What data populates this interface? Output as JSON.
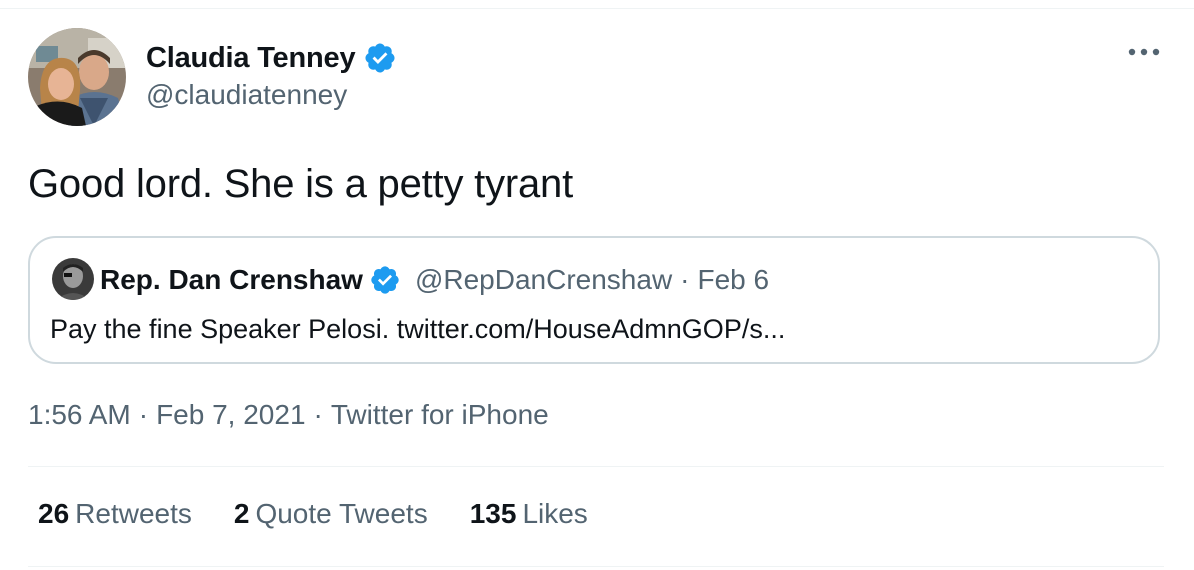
{
  "tweet": {
    "author": {
      "display_name": "Claudia Tenney",
      "handle": "@claudiatenney",
      "verified": true
    },
    "text": "Good lord. She is a petty tyrant",
    "quoted": {
      "author": {
        "display_name": "Rep. Dan Crenshaw",
        "handle": "@RepDanCrenshaw",
        "verified": true
      },
      "separator": "·",
      "date": "Feb 6",
      "text": "Pay the fine Speaker Pelosi. twitter.com/HouseAdmnGOP/s..."
    },
    "meta": {
      "time": "1:56 AM",
      "separator": "·",
      "date": "Feb 7, 2021",
      "source": "Twitter for iPhone"
    },
    "stats": {
      "retweets_count": "26",
      "retweets_label": "Retweets",
      "quote_tweets_count": "2",
      "quote_tweets_label": "Quote Tweets",
      "likes_count": "135",
      "likes_label": "Likes"
    }
  },
  "icons": {
    "verified": "verified-badge-icon",
    "more": "more-options-icon"
  },
  "colors": {
    "verified_blue": "#1d9bf0",
    "primary_text": "#0f1419",
    "secondary_text": "#536471",
    "border": "#cfd9de"
  }
}
